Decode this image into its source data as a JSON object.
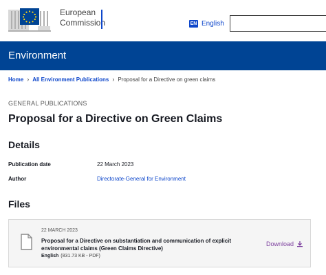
{
  "header": {
    "logo_text_line1": "European",
    "logo_text_line2": "Commission",
    "language_code": "EN",
    "language_label": "English",
    "search_placeholder": ""
  },
  "banner": {
    "title": "Environment"
  },
  "breadcrumb": {
    "items": [
      {
        "label": "Home"
      },
      {
        "label": "All Environment Publications"
      }
    ],
    "current": "Proposal for a Directive on green claims"
  },
  "publication": {
    "kicker": "GENERAL PUBLICATIONS",
    "title": "Proposal for a Directive on Green Claims"
  },
  "details": {
    "heading": "Details",
    "rows": [
      {
        "label": "Publication date",
        "value": "22 March 2023"
      },
      {
        "label": "Author",
        "value": "Directorate-General for Environment"
      }
    ]
  },
  "files": {
    "heading": "Files",
    "items": [
      {
        "date": "22 MARCH 2023",
        "title": "Proposal for a Directive on substantiation and communication of explicit environmental claims (Green Claims Directive)",
        "language": "English",
        "size": "(831.73 KB - PDF)",
        "action_label": "Download"
      }
    ]
  },
  "colors": {
    "ec_blue": "#004494",
    "link_blue": "#0e47cb",
    "flag_yellow": "#ffd617",
    "download_purple": "#7c3e9e"
  },
  "icons": [
    "eu-flag-logo",
    "language-icon",
    "chevron-right-icon",
    "file-icon",
    "download-icon"
  ]
}
